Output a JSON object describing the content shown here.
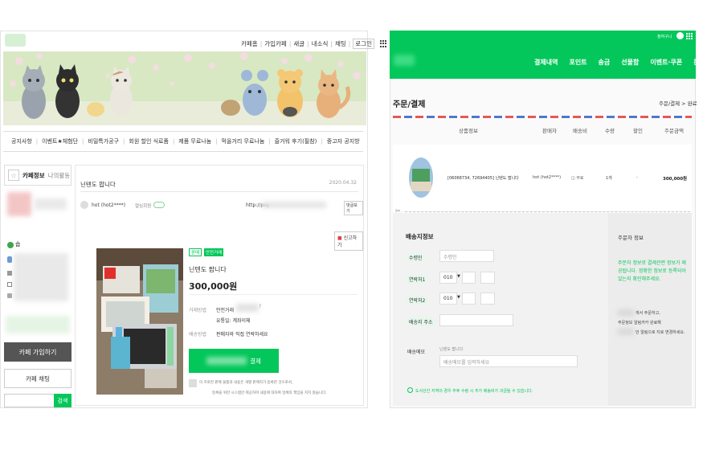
{
  "left_panel": {
    "top_nav": [
      "카페홈",
      "가입카페",
      "새글",
      "내소식",
      "채팅",
      "로그인"
    ],
    "menu": [
      "공지사항",
      "이벤트★체험단",
      "비밀특가공구",
      "회원 할인 식료품",
      "제품 무료나눔",
      "먹을거리 무료나눔",
      "즐거워 후기(필참)",
      "중고자 공지방"
    ],
    "sidebar": {
      "tab_info": "카페정보",
      "tab_activity": "나의활동",
      "join_button": "카페 가입하기",
      "chat_button": "카페 채팅",
      "search_button": "검색"
    },
    "post": {
      "title": "닌텐도 팝니다",
      "date": "2020.04.32",
      "author": "hot (hot2****)",
      "author_level": "열심회원",
      "link": "http://pay",
      "quick_reply": "댓글보기",
      "report": "신고하기",
      "tags": [
        "판매",
        "안전거래"
      ],
      "product_name": "닌텐도 팝니다",
      "price": "300,000원",
      "fields": [
        {
          "label": "거래방법",
          "value": "안전거래"
        },
        {
          "label": "",
          "value": "유통일: 계좌이체"
        },
        {
          "label": "배송방법",
          "value": "판매자와 직접 연락하세요"
        }
      ],
      "pay_button": "결제",
      "notice_line1": "이 프로한 판매 물품과 내용은 개별 판매자가 등록한 것으로서,",
      "notice_line2": "등록을 위한 시스템만 제공하며 내용에 대하여 일체의 책임을 지지 않습니다."
    }
  },
  "right_panel": {
    "header_nav": [
      "결제내역",
      "포인트",
      "송금",
      "선물함",
      "이벤트·쿠폰",
      "문의·리뷰"
    ],
    "header_user": "참여구니",
    "page_title": "주문/결제",
    "breadcrumb": "주문/결제 > 완료",
    "table_headers": [
      "상품정보",
      "판매자",
      "배송비",
      "수량",
      "할인",
      "주문금액"
    ],
    "product_row": {
      "name": "[06068734, 72694405] 닌텐도 팝니다",
      "seller": "hot (hot2****)",
      "shipping": "무료",
      "qty": "1개",
      "discount": "-",
      "amount": "300,000원"
    },
    "delivery": {
      "section_title": "배송지정보",
      "recipient_label": "수령인",
      "recipient_placeholder": "수령인",
      "phone1_label": "연락처1",
      "phone2_label": "연락처2",
      "phone_prefix": "010",
      "address_label": "배송지 주소",
      "memo_label": "배송메모",
      "memo_hint": "닌텐도 팝니다",
      "memo_placeholder": "배송메모를 입력하세요",
      "footer_note": "도서산간 지역의 경우 추후 수령 시 추가 배송비가 과금될 수 있습니다."
    },
    "order_info": {
      "title": "주문자 정보",
      "green_note": "주문자 정보로 결제관련 정보가 제공됩니다. 정확한 정보로 등록되어 있는지 확인해주세요.",
      "note_line1": "게서 주문하고,",
      "note_line2": "주문정보 알림카카 완료해",
      "note_line3": "안 알림으로 지로 변경하세요."
    }
  }
}
